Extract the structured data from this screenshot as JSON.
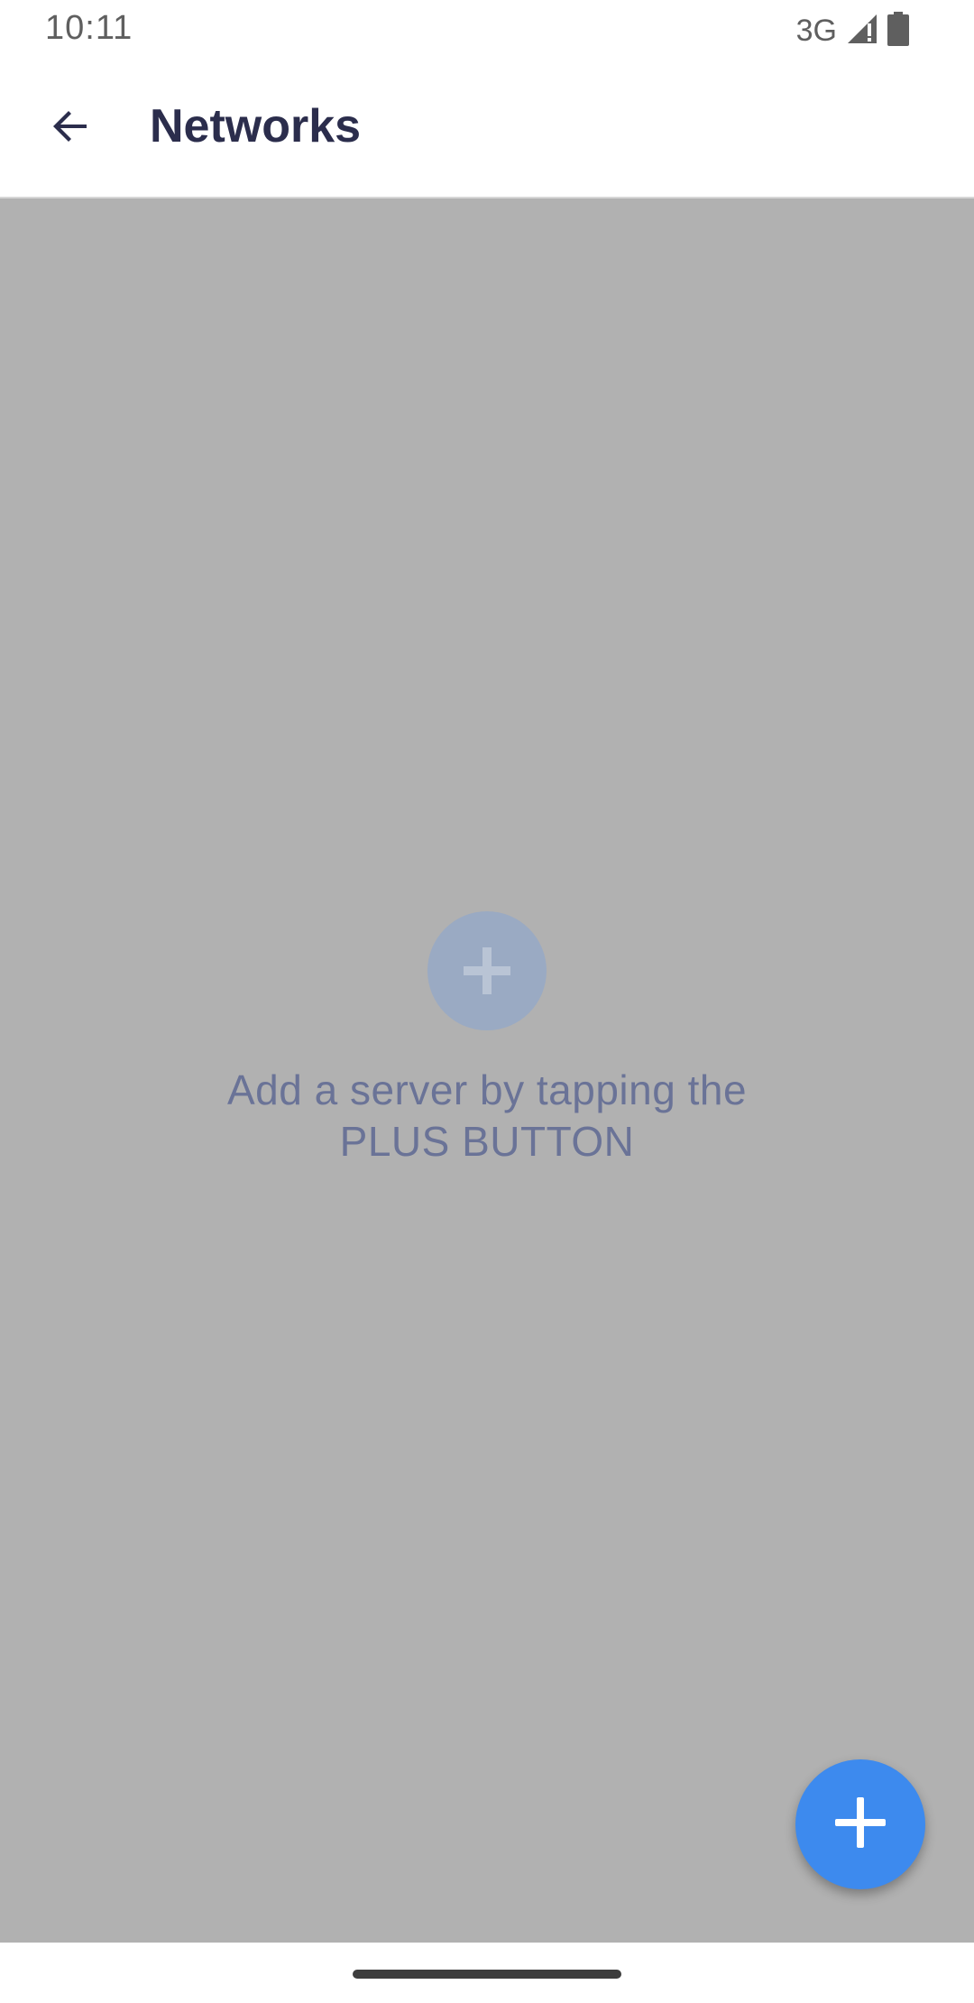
{
  "status_bar": {
    "time": "10:11",
    "network": "3G",
    "icons": [
      "signal-icon",
      "battery-icon"
    ]
  },
  "toolbar": {
    "back_icon": "arrow-left-icon",
    "title": "Networks"
  },
  "empty_state": {
    "icon": "plus-circle-icon",
    "line1": "Add a server by tapping the",
    "line2": "PLUS BUTTON"
  },
  "fab": {
    "icon": "plus-icon",
    "color": "#3d8aee"
  },
  "colors": {
    "title": "#2b2d4c",
    "content_background": "#b1b1b1",
    "empty_text": "#6a7397",
    "empty_icon_background": "#9aaac3"
  }
}
